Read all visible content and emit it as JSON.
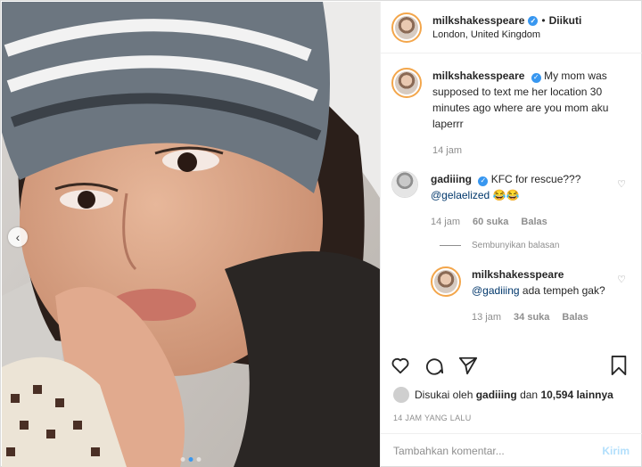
{
  "post": {
    "username": "milkshakesspeare",
    "follow_label": "Diikuti",
    "location": "London, United Kingdom"
  },
  "caption": {
    "username": "milkshakesspeare",
    "text": "My mom was supposed to text me her location 30 minutes ago where are you mom aku laperrr",
    "time": "14 jam"
  },
  "comment1": {
    "username": "gadiiing",
    "text": "KFC for rescue???",
    "mention": "@gelaelized",
    "emoji": "😂😂",
    "time": "14 jam",
    "likes": "60 suka",
    "reply_label": "Balas",
    "hide_replies": "Sembunyikan balasan"
  },
  "reply1": {
    "username": "milkshakesspeare",
    "mention": "@gadiiing",
    "text": "ada tempeh gak?",
    "time": "13 jam",
    "likes": "34 suka",
    "reply_label": "Balas"
  },
  "likes": {
    "prefix": "Disukai oleh",
    "user": "gadiiing",
    "and": "dan",
    "count": "10,594 lainnya"
  },
  "time_ago": "14 JAM YANG LALU",
  "add_comment": {
    "placeholder": "Tambahkan komentar...",
    "post_label": "Kirim"
  },
  "carousel": {
    "total": 3,
    "active_index": 1
  },
  "colors": {
    "accent": "#3897f0",
    "verified": "#3897f0",
    "muted": "#8e8e8e"
  },
  "icons": [
    "chevron-left-icon",
    "heart-icon",
    "comment-icon",
    "share-icon",
    "bookmark-icon",
    "verified-badge-icon"
  ]
}
